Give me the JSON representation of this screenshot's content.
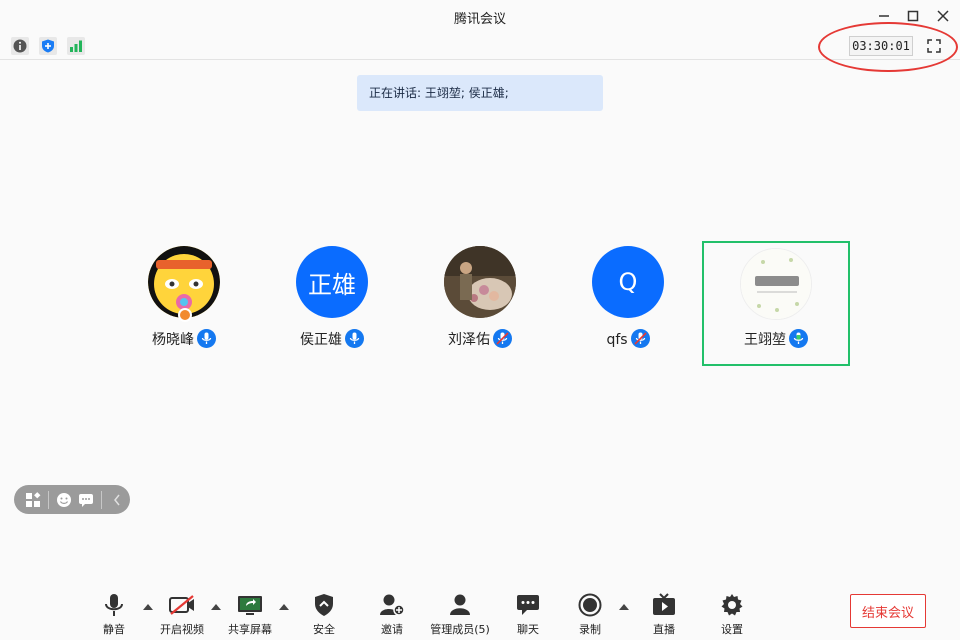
{
  "window": {
    "title": "腾讯会议"
  },
  "status": {
    "timer": "03:30:01",
    "speaking": "正在讲话: 王翊堃; 侯正雄;"
  },
  "participants": [
    {
      "name": "杨晓峰",
      "avatar": "emoji-face",
      "mic": "on"
    },
    {
      "name": "侯正雄",
      "avatar_text": "正雄",
      "mic": "on"
    },
    {
      "name": "刘泽佑",
      "avatar": "photo",
      "mic": "muted"
    },
    {
      "name": "qfs",
      "avatar_text": "Q",
      "mic": "muted"
    },
    {
      "name": "王翊堃",
      "avatar": "logo",
      "mic": "speaking",
      "active": true
    }
  ],
  "toolbar": {
    "mute": "静音",
    "video": "开启视频",
    "share": "共享屏幕",
    "security": "安全",
    "invite": "邀请",
    "members": "管理成员(5)",
    "chat": "聊天",
    "record": "录制",
    "live": "直播",
    "settings": "设置",
    "end": "结束会议"
  },
  "colors": {
    "accent": "#0a6cff",
    "active_border": "#22c06a",
    "end": "#e53935"
  }
}
